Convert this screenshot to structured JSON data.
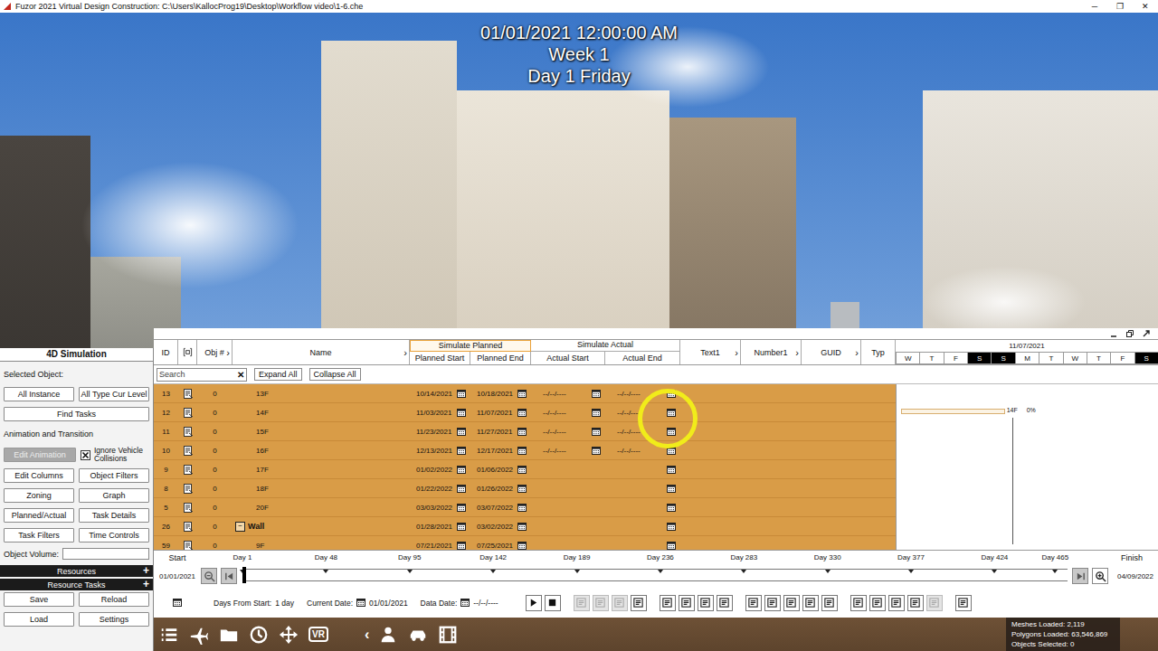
{
  "window": {
    "title": "Fuzor 2021 Virtual Design Construction: C:\\Users\\KallocProg19\\Desktop\\Workflow video\\1-6.che",
    "controls": [
      "─",
      "❐",
      "✕"
    ]
  },
  "overlay": {
    "date": "01/01/2021 12:00:00 AM",
    "week": "Week 1",
    "day": "Day 1 Friday"
  },
  "left_panel": {
    "items": [
      {
        "kind": "title",
        "text": "4D Simulation"
      },
      {
        "kind": "label",
        "text": "Selected Object:"
      },
      {
        "kind": "buttons",
        "buttons": [
          {
            "label": "All Instance",
            "disabled": false
          },
          {
            "label": "All Type Cur Level",
            "disabled": false
          }
        ]
      },
      {
        "kind": "buttons",
        "buttons": [
          {
            "label": "Find Tasks",
            "disabled": false
          }
        ]
      },
      {
        "kind": "label",
        "text": "Animation and Transition"
      },
      {
        "kind": "anim",
        "buttons": [
          {
            "label": "Edit Animation",
            "disabled": true
          }
        ],
        "checkbox": {
          "label": "Ignore Vehicle Collisions",
          "checked": true
        }
      },
      {
        "kind": "buttons",
        "buttons": [
          {
            "label": "Edit Columns",
            "disabled": false
          },
          {
            "label": "Object Filters",
            "disabled": false
          }
        ]
      },
      {
        "kind": "buttons",
        "buttons": [
          {
            "label": "Zoning",
            "disabled": false
          },
          {
            "label": "Graph",
            "disabled": false
          }
        ]
      },
      {
        "kind": "buttons",
        "buttons": [
          {
            "label": "Planned/Actual",
            "disabled": false
          },
          {
            "label": "Task Details",
            "disabled": false
          }
        ]
      },
      {
        "kind": "buttons",
        "buttons": [
          {
            "label": "Task Filters",
            "disabled": false
          },
          {
            "label": "Time Controls",
            "disabled": false
          }
        ]
      },
      {
        "kind": "field",
        "label": "Object Volume:",
        "value": ""
      },
      {
        "kind": "bar",
        "text": "Resources",
        "toggle": "+"
      },
      {
        "kind": "bar",
        "text": "Resource Tasks",
        "toggle": "+"
      },
      {
        "kind": "buttons",
        "buttons": [
          {
            "label": "Save",
            "disabled": false
          },
          {
            "label": "Reload",
            "disabled": false
          }
        ]
      },
      {
        "kind": "buttons",
        "buttons": [
          {
            "label": "Load",
            "disabled": false
          },
          {
            "label": "Settings",
            "disabled": false
          }
        ]
      }
    ]
  },
  "table": {
    "header": [
      {
        "label": "ID",
        "mark": ""
      },
      {
        "label": "",
        "mark": "",
        "icon": true
      },
      {
        "label": "Obj #",
        "mark": "›"
      },
      {
        "label": "Name",
        "mark": "›"
      },
      {
        "group": "Simulate Planned",
        "selected": true,
        "columns": [
          "Planned Start",
          "Planned End"
        ]
      },
      {
        "group": "Simulate Actual",
        "selected": false,
        "columns": [
          "Actual Start",
          "Actual End"
        ]
      },
      {
        "label": "Text1",
        "mark": "›"
      },
      {
        "label": "Number1",
        "mark": "›"
      },
      {
        "label": "GUID",
        "mark": "›"
      },
      {
        "label": "Typ",
        "mark": ""
      }
    ],
    "search": {
      "placeholder": "Search",
      "clear": "✕"
    },
    "buttons": [
      "Expand All",
      "Collapse All"
    ],
    "gantt": {
      "date": "11/07/2021",
      "days": [
        {
          "label": "W",
          "weekend": false
        },
        {
          "label": "T",
          "weekend": false
        },
        {
          "label": "F",
          "weekend": false
        },
        {
          "label": "S",
          "weekend": true
        },
        {
          "label": "S",
          "weekend": true
        },
        {
          "label": "M",
          "weekend": false
        },
        {
          "label": "T",
          "weekend": false
        },
        {
          "label": "W",
          "weekend": false
        },
        {
          "label": "T",
          "weekend": false
        },
        {
          "label": "F",
          "weekend": false
        },
        {
          "label": "S",
          "weekend": true
        }
      ]
    },
    "rows": [
      {
        "kind": "task",
        "id": "13",
        "obj": "0",
        "name": "13F",
        "planned_start": "10/14/2021",
        "planned_end": "10/18/2021",
        "actual_start": "--/--/----",
        "actual_end": "--/--/----"
      },
      {
        "kind": "task",
        "id": "12",
        "obj": "0",
        "name": "14F",
        "planned_start": "11/03/2021",
        "planned_end": "11/07/2021",
        "actual_start": "--/--/----",
        "actual_end": "--/--/----",
        "gantt_bar": {
          "from": 0.017,
          "to": 0.414,
          "label": "14F",
          "percent": "0%"
        }
      },
      {
        "kind": "task",
        "id": "11",
        "obj": "0",
        "name": "15F",
        "planned_start": "11/23/2021",
        "planned_end": "11/27/2021",
        "actual_start": "--/--/----",
        "actual_end": "--/--/----"
      },
      {
        "kind": "task",
        "id": "10",
        "obj": "0",
        "name": "16F",
        "planned_start": "12/13/2021",
        "planned_end": "12/17/2021",
        "actual_start": "--/--/----",
        "actual_end": "--/--/----"
      },
      {
        "kind": "task",
        "id": "9",
        "obj": "0",
        "name": "17F",
        "planned_start": "01/02/2022",
        "planned_end": "01/06/2022",
        "actual_start": "",
        "actual_end": ""
      },
      {
        "kind": "task",
        "id": "8",
        "obj": "0",
        "name": "18F",
        "planned_start": "01/22/2022",
        "planned_end": "01/26/2022",
        "actual_start": "",
        "actual_end": ""
      },
      {
        "kind": "task",
        "id": "5",
        "obj": "0",
        "name": "20F",
        "planned_start": "03/03/2022",
        "planned_end": "03/07/2022",
        "actual_start": "",
        "actual_end": ""
      },
      {
        "kind": "group",
        "id": "26",
        "obj": "0",
        "name": "Wall",
        "toggle": "−",
        "expanded": true,
        "planned_start": "01/28/2021",
        "planned_end": "03/02/2022",
        "actual_start": "",
        "actual_end": ""
      },
      {
        "kind": "task",
        "id": "59",
        "obj": "0",
        "name": "9F",
        "planned_start": "07/21/2021",
        "planned_end": "07/25/2021",
        "actual_start": "",
        "actual_end": ""
      }
    ]
  },
  "timeline": {
    "start_label": "Start",
    "start_date": "01/01/2021",
    "finish_label": "Finish",
    "finish_date": "04/09/2022",
    "ticks": [
      {
        "label": "Day 1",
        "at": 0
      },
      {
        "label": "Day 48",
        "at": 0.1013
      },
      {
        "label": "Day 95",
        "at": 0.2026
      },
      {
        "label": "Day 142",
        "at": 0.3039
      },
      {
        "label": "Day 189",
        "at": 0.4052
      },
      {
        "label": "Day 236",
        "at": 0.5065
      },
      {
        "label": "Day 283",
        "at": 0.6078
      },
      {
        "label": "Day 330",
        "at": 0.7091
      },
      {
        "label": "Day 377",
        "at": 0.8103
      },
      {
        "label": "Day 424",
        "at": 0.9116
      },
      {
        "label": "Day 465",
        "at": 0.985
      }
    ],
    "level": 0,
    "days_from_start_label": "Days From Start:",
    "days_from_start": "1 day",
    "current_date_label": "Current Date:",
    "current_date": "01/01/2021",
    "data_date_label": "Data Date:",
    "data_date": "--/--/----",
    "transport": [
      {
        "kind": "play",
        "disabled": false
      },
      {
        "kind": "stop",
        "disabled": false
      }
    ],
    "tool_groups": [
      [
        {
          "disabled": true
        },
        {
          "disabled": true
        },
        {
          "disabled": true
        },
        {
          "disabled": false
        }
      ],
      [
        {
          "disabled": false
        },
        {
          "disabled": false
        },
        {
          "disabled": false
        },
        {
          "disabled": false
        }
      ],
      [
        {
          "disabled": false
        },
        {
          "disabled": false
        },
        {
          "disabled": false
        },
        {
          "disabled": false
        },
        {
          "disabled": false
        }
      ],
      [
        {
          "disabled": false
        },
        {
          "disabled": false
        },
        {
          "disabled": false
        },
        {
          "disabled": false
        },
        {
          "disabled": true
        }
      ],
      [
        {
          "disabled": false
        }
      ]
    ]
  },
  "bottom_toolbar": {
    "tools": [
      {
        "kind": "list",
        "text": ""
      },
      {
        "kind": "drone",
        "text": ""
      },
      {
        "kind": "folder",
        "text": ""
      },
      {
        "kind": "clock",
        "text": ""
      },
      {
        "kind": "move",
        "text": ""
      },
      {
        "kind": "vr",
        "text": "VR"
      }
    ],
    "collapse": "‹",
    "extras": [
      {
        "kind": "person"
      },
      {
        "kind": "vehicle"
      },
      {
        "kind": "film"
      }
    ]
  },
  "stats": [
    "Meshes Loaded: 2,119",
    "Polygons Loaded: 63,546,869",
    "Objects Selected: 0"
  ],
  "cursor_highlight": {
    "visible": true
  }
}
